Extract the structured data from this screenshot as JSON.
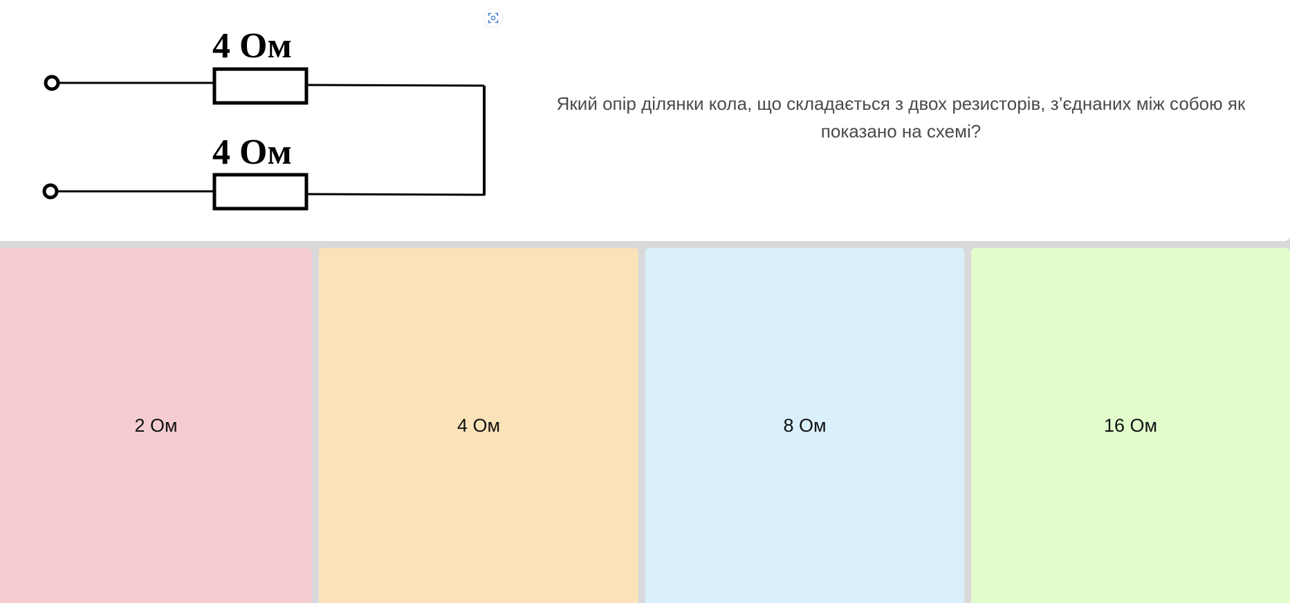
{
  "question": {
    "text": "Який опір ділянки кола, що складається з двох резисторів, з’єднаних між собою як показано на схемі?",
    "diagram": {
      "top_resistor_label": "4 Ом",
      "bottom_resistor_label": "4 Ом"
    },
    "zoom_icon": "expand-image-icon"
  },
  "answers": [
    {
      "label": "2 Ом",
      "color": "#f5cdd0"
    },
    {
      "label": "4 Ом",
      "color": "#fae2b9"
    },
    {
      "label": "8 Ом",
      "color": "#d9f0fa"
    },
    {
      "label": "16 Ом",
      "color": "#e2fccb"
    }
  ],
  "colors": {
    "page_background": "#d9d9dc",
    "card_background": "#ffffff",
    "question_text": "#4a4a4a",
    "icon_accent": "#3a7bd5"
  }
}
